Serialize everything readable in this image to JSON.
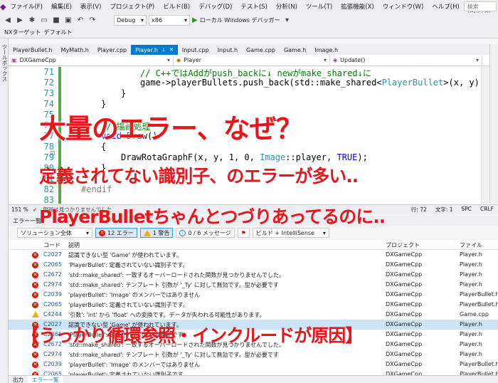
{
  "menubar": {
    "items": [
      "ファイル(F)",
      "編集(E)",
      "表示(V)",
      "プロジェクト(P)",
      "ビルド(B)",
      "デバッグ(D)",
      "テスト(S)",
      "分析(N)",
      "ツール(T)",
      "拡張機能(X)",
      "ウィンドウ(W)",
      "ヘルプ(H)"
    ],
    "search_placeholder": "検索 (Ctrl+Q)"
  },
  "toolbar": {
    "config": "Debug",
    "platform": "x86",
    "run_label": "ローカル Windows デバッガー"
  },
  "toolbar2": {
    "nx_target": "NXターゲット",
    "nx_default": "デフォルト"
  },
  "leftstrip": {
    "label": "ツールボックス"
  },
  "tabs": [
    {
      "label": "PlayerBullet.h"
    },
    {
      "label": "MyMath.h"
    },
    {
      "label": "Player.cpp"
    },
    {
      "label": "Player.h",
      "active": true
    },
    {
      "label": "Input.cpp"
    },
    {
      "label": "Input.h"
    },
    {
      "label": "Game.cpp"
    },
    {
      "label": "Game.h"
    },
    {
      "label": "Image.h"
    }
  ],
  "navbar": {
    "project": "DXGameCpp",
    "scope": "Player",
    "member": "Update()"
  },
  "editor": {
    "line_numbers": [
      "71",
      "72",
      "73",
      "74",
      "75",
      "76",
      "77",
      "78",
      "79",
      "80",
      "81",
      "82",
      "83"
    ],
    "lines": {
      "l71": "// C++ではAddがpush_backに↓ newがmake_shared↓に",
      "l72a": "game->playerBullets.push_back(std::make_shared<",
      "l72b": "PlayerBullet",
      "l72c": ">(x, y));",
      "l73": "}",
      "l74": "}",
      "l76": "// 描画処理",
      "l77a": "void",
      "l77b": " Draw()",
      "l78": "{",
      "l79a": "DrawRotaGraphF(x, y, 1, 0, ",
      "l79b": "Image",
      "l79c": "::player, ",
      "l79d": "TRUE",
      "l79e": ");",
      "l80": "}",
      "l82": "#endif"
    }
  },
  "statusbar": {
    "zoom": "151 %",
    "issues": "問題は見つかりませんでした",
    "line": "行: 72",
    "char": "文字: 1",
    "spc": "SPC",
    "crlf": "CRLF"
  },
  "errorlist": {
    "title": "エラー一覧",
    "scope": "ソリューション全体",
    "errors_label": "12 エラー",
    "warnings_label": "1 警告",
    "messages_label": "0 / 6 メッセージ",
    "build_filter": "ビルド + IntelliSense",
    "columns": {
      "code": "コード",
      "desc": "説明",
      "project": "プロジェクト",
      "file": "ファイル"
    },
    "rows": [
      {
        "type": "error",
        "code": "C2027",
        "desc": "認識できない型 'Game' が使われています。",
        "project": "DXGameCpp",
        "file": "Player.h"
      },
      {
        "type": "error",
        "code": "C2065",
        "desc": "'PlayerBullet': 定義されていない識別子です。",
        "project": "DXGameCpp",
        "file": "Player.h"
      },
      {
        "type": "error",
        "code": "C2672",
        "desc": "'std::make_shared': 一致するオーバーロードされた関数が見つかりませんでした。",
        "project": "DXGameCpp",
        "file": "Player.h"
      },
      {
        "type": "error",
        "code": "C2974",
        "desc": "'std::make_shared': テンプレート 引数が '_Ty' に対して無効です。型が必要です",
        "project": "DXGameCpp",
        "file": "Player.h"
      },
      {
        "type": "error",
        "code": "C2039",
        "desc": "'playerBullet': 'Image' のメンバーではありません",
        "project": "DXGameCpp",
        "file": "PlayerBullet.h"
      },
      {
        "type": "error",
        "code": "C2065",
        "desc": "'playerBullet': 定義されていない識別子です。",
        "project": "DXGameCpp",
        "file": "PlayerBullet.h"
      },
      {
        "type": "warning",
        "code": "C4244",
        "desc": "'引数': 'int' から 'float' への変換です。データが失われる可能性があります。",
        "project": "DXGameCpp",
        "file": "Game.cpp"
      },
      {
        "type": "error",
        "code": "C2027",
        "desc": "認識できない型 'Game' が使われています。",
        "project": "DXGameCpp",
        "file": "Player.h",
        "selected": true
      },
      {
        "type": "error",
        "code": "C2065",
        "desc": "'PlayerBullet': 定義されていない識別子です。",
        "project": "DXGameCpp",
        "file": "Player.h"
      },
      {
        "type": "error",
        "code": "C2672",
        "desc": "'std::make_shared': 一致するオーバーロードされた関数が見つかりませんでした。",
        "project": "DXGameCpp",
        "file": "Player.h"
      },
      {
        "type": "error",
        "code": "C2974",
        "desc": "'std::make_shared': テンプレート 引数が '_Ty' に対して無効です。型が必要です",
        "project": "DXGameCpp",
        "file": "Player.h"
      },
      {
        "type": "error",
        "code": "C2039",
        "desc": "'playerBullet': 'Image' のメンバーではありません",
        "project": "DXGameCpp",
        "file": "PlayerBullet.h"
      },
      {
        "type": "error",
        "code": "C2065",
        "desc": "'playerBullet': 定義されていない識別子です。",
        "project": "DXGameCpp",
        "file": "PlayerBullet.h"
      }
    ]
  },
  "bottomtabs": [
    "出力",
    "エラー一覧"
  ],
  "overlays": {
    "headline": "大量のエラー、なぜ？",
    "line2": "定義されてない識別子、のエラーが多い..",
    "line3": "PlayerBulletちゃんとつづりあってるのに..",
    "answer": "【うっかり循環参照・インクルードが原因】"
  },
  "colors": {
    "accent": "#007acc",
    "overlay_text": "#e8151b",
    "error": "#e51400",
    "warning": "#f0b000"
  }
}
